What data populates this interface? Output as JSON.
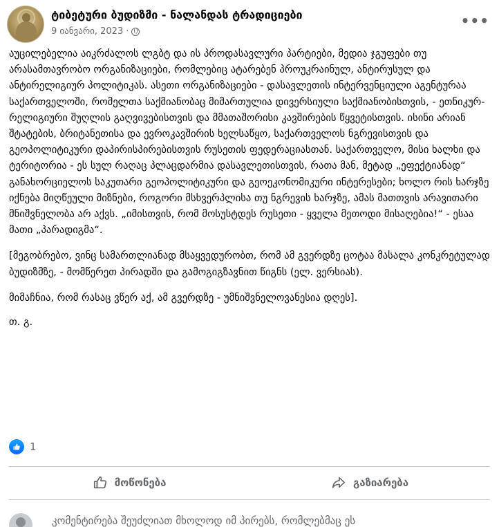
{
  "post": {
    "page_name": "ტიბეტური ბუდიზმი - ნალანდას ტრადიციები",
    "date": "9 იანვარი, 2023",
    "separator": "·",
    "more_icon": "more-horizontal-icon",
    "privacy_icon": "globe-icon",
    "paragraphs": [
      "აუცილებელია აიკრძალოს ლგბტ და ის პროდასავლური პარტიები, მედია ჯგუფები თუ არასამთავრობო ორგანიზაციები, რომლებიც ატარებენ პროუკრაინულ, ანტირუსულ და ანტირელიგიურ პოლიტიკას. ასეთი ორგანიზაციები - დასავლეთის ინტერვენციული აგენტურაა საქართველოში, რომელთა საქმიანობაც მიმართულია დივერსიული საქმიანობისთვის, - ეთნიკურ-რელიგიური შუღლის გაღვივებისთვის და მმათაშორისი კავშირების წყვეტისთვის. ისინი არიან შტატების, ბრიტანეთისა და ევროკავშირის ხელსაწყო, საქართველოს ნგრევისთვის და გეოპოლიტიკური დაპირისპირებისთვის რუსეთის ფედერაციასთან. საქართველო, მისი ხალხი და ტერიტორია - ეს სულ რაღაც პლაცდარმია დასავლეთისთვის, რათა მან, მეტად „ეფექტიანად“ განახორციელოს საკუთარი გეოპოლიტიკური და გეოეკონომიკური ინტერესები; ხოლო რის ხარჯზე იქნება მიღწეული მიზნები, როგორი მსხვერპლისა თუ ნგრევის ხარჯზე, ამას მათთვის არავითარი მნიშვნელობა არ აქვს. „იმისთვის, რომ მოსუსტდეს რუსეთი - ყველა მეთოდი მისაღებია!“ - ესაა მათი „პარადიგმა“.",
      "[მეგობრებო, ვინც სამართლიანად მსაყვედურობთ, რომ ამ გვერდზე ცოტაა მასალა კონკრეტულად ბუდიზმზე, - მომწერეთ პირადში და გამოგიგზავნით წიგნს (ელ. ვერსიას).",
      "მიმაჩნია, რომ რასაც ვწერ აქ, ამ გვერდზე - უმნიშვნელოვანესია დღეს].",
      "თ. გ."
    ]
  },
  "reactions": {
    "icon": "like-icon",
    "count": "1",
    "color": "#0866ff"
  },
  "actions": {
    "like_label": "მოწონება",
    "share_label": "გაზიარება",
    "like_icon": "thumbs-up-icon",
    "share_icon": "share-arrow-icon"
  },
  "comments": {
    "notice": "კომენტირება შეუძლიათ მხოლოდ იმ პირებს, რომლებმაც ეს"
  }
}
